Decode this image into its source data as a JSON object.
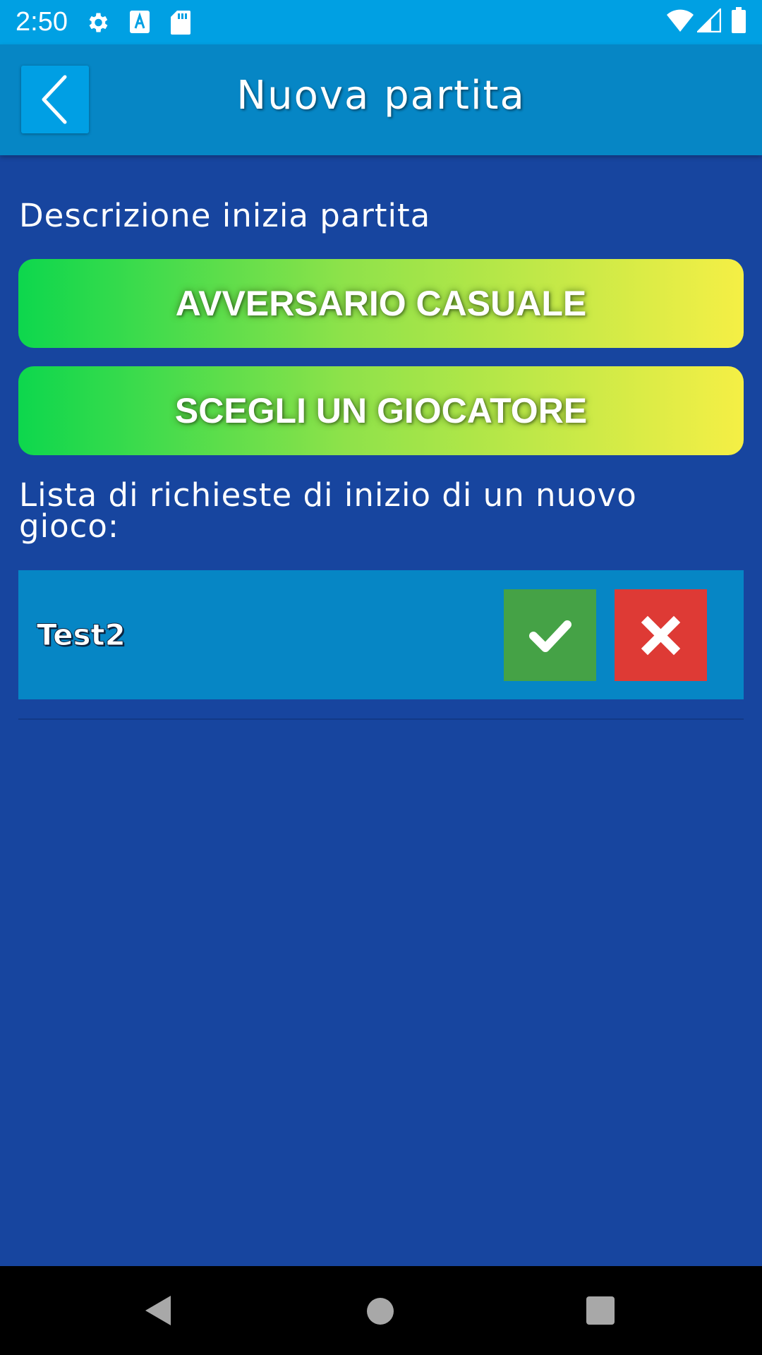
{
  "status_bar": {
    "time": "2:50",
    "left_icons": [
      "gear-icon",
      "text-a-icon",
      "sd-card-icon"
    ],
    "right_icons": [
      "wifi-icon",
      "signal-icon",
      "battery-icon"
    ]
  },
  "app_bar": {
    "title": "Nuova partita",
    "back_icon": "chevron-left-icon"
  },
  "main": {
    "description": "Descrizione inizia partita",
    "random_opponent_label": "AVVERSARIO CASUALE",
    "choose_player_label": "SCEGLI UN GIOCATORE",
    "requests_heading": "Lista di richieste di inizio di un nuovo gioco:",
    "requests": [
      {
        "name": "Test2",
        "accept_icon": "check-icon",
        "reject_icon": "close-icon"
      }
    ]
  },
  "nav_bar": {
    "icons": [
      "back-triangle-icon",
      "home-circle-icon",
      "recents-square-icon"
    ]
  },
  "colors": {
    "background": "#17459f",
    "status_bar": "#00a0e3",
    "app_bar": "#0686c5",
    "accept": "#45a246",
    "reject": "#de3a35",
    "gradient_start": "#0dd74d",
    "gradient_end": "#f5ef45"
  }
}
